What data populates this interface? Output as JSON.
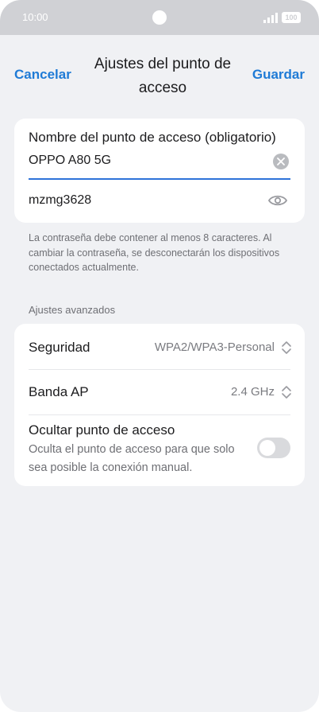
{
  "status_bar": {
    "time": "10:00",
    "battery": "100"
  },
  "header": {
    "cancel_label": "Cancelar",
    "title": "Ajustes del punto de acceso",
    "save_label": "Guardar"
  },
  "hotspot_name": {
    "label": "Nombre del punto de acceso (obligatorio)",
    "value": "OPPO A80 5G"
  },
  "password": {
    "value": "mzmg3628"
  },
  "hint": "La contraseña debe contener al menos 8 caracteres. Al cambiar la contraseña, se desconectarán los dispositivos conectados actualmente.",
  "advanced": {
    "section_label": "Ajustes avanzados",
    "security": {
      "label": "Seguridad",
      "value": "WPA2/WPA3-Personal"
    },
    "band": {
      "label": "Banda AP",
      "value": "2.4 GHz"
    },
    "hide": {
      "label": "Ocultar punto de acceso",
      "description": "Oculta el punto de acceso para que solo sea posible la conexión manual.",
      "enabled": false
    }
  },
  "colors": {
    "accent": "#1f7bd6",
    "background": "#f0f1f4",
    "card": "#ffffff"
  },
  "icons": [
    "signal-icon",
    "battery-icon",
    "clear-icon",
    "eye-icon",
    "chevron-updown-icon"
  ]
}
